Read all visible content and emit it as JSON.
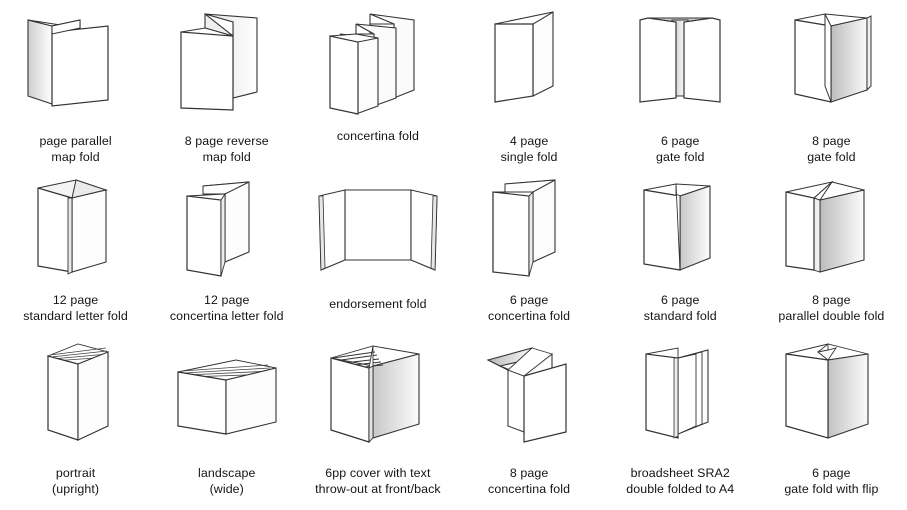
{
  "page": {
    "title": "Paper folding styles reference chart",
    "background_color": "#ffffff",
    "stroke_color": "#333333",
    "fill_color": "#ffffff",
    "shade_color": "#d9d9d9",
    "text_color": "#141414",
    "columns": 6,
    "rows": 3,
    "item_count": 18
  },
  "items": [
    {
      "id": "page-parallel-map-fold",
      "line1": "page parallel",
      "line2": "map fold",
      "row": 1,
      "col": 1
    },
    {
      "id": "8-page-reverse-map-fold",
      "line1": "8 page reverse",
      "line2": "map fold",
      "row": 1,
      "col": 2
    },
    {
      "id": "concertina-fold",
      "line1": "concertina fold",
      "line2": "",
      "row": 1,
      "col": 3
    },
    {
      "id": "4-page-single-fold",
      "line1": "4 page",
      "line2": "single fold",
      "row": 1,
      "col": 4
    },
    {
      "id": "6-page-gate-fold",
      "line1": "6 page",
      "line2": "gate fold",
      "row": 1,
      "col": 5
    },
    {
      "id": "8-page-gate-fold",
      "line1": "8 page",
      "line2": "gate fold",
      "row": 1,
      "col": 6
    },
    {
      "id": "12-page-standard-letter-fold",
      "line1": "12 page",
      "line2": "standard letter fold",
      "row": 2,
      "col": 1
    },
    {
      "id": "12-page-concertina-letter-fold",
      "line1": "12 page",
      "line2": "concertina letter fold",
      "row": 2,
      "col": 2
    },
    {
      "id": "endorsement-fold",
      "line1": "endorsement fold",
      "line2": "",
      "row": 2,
      "col": 3
    },
    {
      "id": "6-page-concertina-fold",
      "line1": "6 page",
      "line2": "concertina fold",
      "row": 2,
      "col": 4
    },
    {
      "id": "6-page-standard-fold",
      "line1": "6 page",
      "line2": "standard fold",
      "row": 2,
      "col": 5
    },
    {
      "id": "8-page-parallel-double-fold",
      "line1": "8 page",
      "line2": "parallel double fold",
      "row": 2,
      "col": 6
    },
    {
      "id": "portrait-upright",
      "line1": "portrait",
      "line2": "(upright)",
      "row": 3,
      "col": 1
    },
    {
      "id": "landscape-wide",
      "line1": "landscape",
      "line2": "(wide)",
      "row": 3,
      "col": 2
    },
    {
      "id": "6pp-cover-throw-out",
      "line1": "6pp cover with text",
      "line2": "throw-out at front/back",
      "row": 3,
      "col": 3
    },
    {
      "id": "8-page-concertina-fold",
      "line1": "8 page",
      "line2": "concertina fold",
      "row": 3,
      "col": 4
    },
    {
      "id": "broadsheet-sra2-double-folded",
      "line1": "broadsheet SRA2",
      "line2": "double folded to A4",
      "row": 3,
      "col": 5
    },
    {
      "id": "6-page-gate-fold-with-flip",
      "line1": "6 page",
      "line2": "gate fold with flip",
      "row": 3,
      "col": 6
    }
  ]
}
